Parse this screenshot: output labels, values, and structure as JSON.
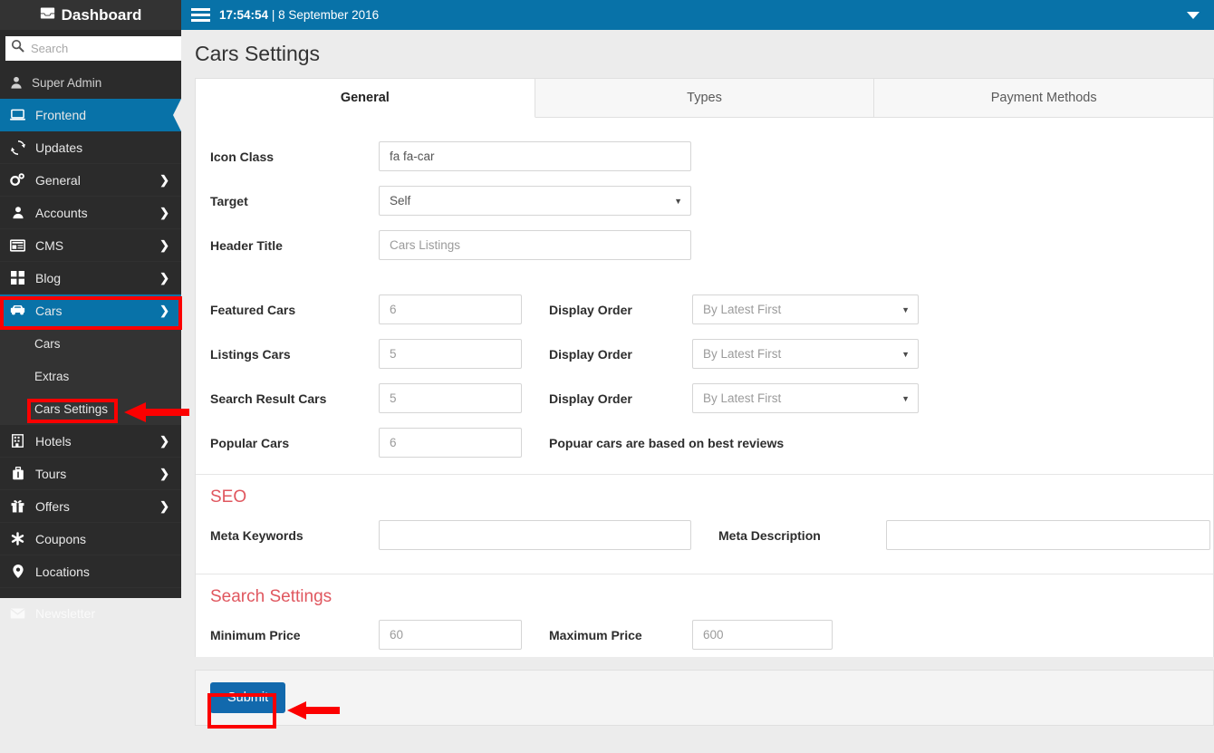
{
  "sidebar": {
    "brand": "Dashboard",
    "brand_icon": "inbox-icon",
    "search_placeholder": "Search",
    "search_value": "",
    "user": "Super Admin",
    "items": [
      {
        "label": "Frontend",
        "icon": "laptop-icon",
        "caret": "",
        "active": true
      },
      {
        "label": "Updates",
        "icon": "refresh-icon",
        "caret": ""
      },
      {
        "label": "General",
        "icon": "gears-icon",
        "caret": "❯"
      },
      {
        "label": "Accounts",
        "icon": "user-icon",
        "caret": "❯"
      },
      {
        "label": "CMS",
        "icon": "window-icon",
        "caret": "❯"
      },
      {
        "label": "Blog",
        "icon": "grid-icon",
        "caret": "❯"
      },
      {
        "label": "Cars",
        "icon": "car-icon",
        "caret": "❯"
      }
    ],
    "sub_items": [
      {
        "label": "Cars"
      },
      {
        "label": "Extras"
      },
      {
        "label": "Cars Settings"
      }
    ],
    "items_after": [
      {
        "label": "Hotels",
        "icon": "building-icon",
        "caret": "❯"
      },
      {
        "label": "Tours",
        "icon": "suitcase-icon",
        "caret": "❯"
      },
      {
        "label": "Offers",
        "icon": "gift-icon",
        "caret": "❯"
      },
      {
        "label": "Coupons",
        "icon": "asterisk-icon",
        "caret": ""
      },
      {
        "label": "Locations",
        "icon": "map-pin-icon",
        "caret": ""
      }
    ],
    "newsletter": {
      "label": "Newsletter",
      "icon": "envelope-icon"
    }
  },
  "topbar": {
    "menu_icon": "hamburger-icon",
    "time": "17:54:54",
    "separator": "|",
    "date": "8 September 2016",
    "caret_icon": "chevron-down-icon"
  },
  "page": {
    "title": "Cars Settings"
  },
  "tabs": [
    {
      "label": "General",
      "active": true
    },
    {
      "label": "Types",
      "active": false
    },
    {
      "label": "Payment Methods",
      "active": false
    }
  ],
  "form": {
    "icon_class": {
      "label": "Icon Class",
      "value": "fa fa-car",
      "placeholder": ""
    },
    "target": {
      "label": "Target",
      "value": "Self"
    },
    "header_title": {
      "label": "Header Title",
      "value": "",
      "placeholder": "Cars Listings"
    },
    "featured_cars": {
      "label": "Featured Cars",
      "value": "",
      "placeholder": "6"
    },
    "listings_cars": {
      "label": "Listings Cars",
      "value": "",
      "placeholder": "5"
    },
    "search_result_cars": {
      "label": "Search Result Cars",
      "value": "",
      "placeholder": "5"
    },
    "popular_cars": {
      "label": "Popular Cars",
      "value": "",
      "placeholder": "6"
    },
    "display_order_label": "Display Order",
    "display_order_value": "By Latest First",
    "popular_note": "Popuar cars are based on best reviews",
    "seo_heading": "SEO",
    "meta_keywords": {
      "label": "Meta Keywords",
      "value": "",
      "placeholder": ""
    },
    "meta_description": {
      "label": "Meta Description",
      "value": "",
      "placeholder": ""
    },
    "search_heading": "Search Settings",
    "minimum_price": {
      "label": "Minimum Price",
      "value": "",
      "placeholder": "60"
    },
    "maximum_price": {
      "label": "Maximum Price",
      "value": "",
      "placeholder": "600"
    },
    "submit_label": "Submit"
  },
  "annotations": {
    "highlight_color": "#fc0000",
    "boxes": [
      "cars-menu-item",
      "cars-settings-sub-item",
      "submit-button"
    ],
    "arrows": [
      "arrow-to-cars-settings",
      "arrow-to-submit"
    ]
  },
  "colors": {
    "accent_blue": "#0872a8",
    "sidebar_dark": "#2b2b2b",
    "submenu_dark": "#333333",
    "section_heading_red": "#e0575f",
    "annotation_red": "#fc0000",
    "submit_blue": "#1269ad"
  }
}
